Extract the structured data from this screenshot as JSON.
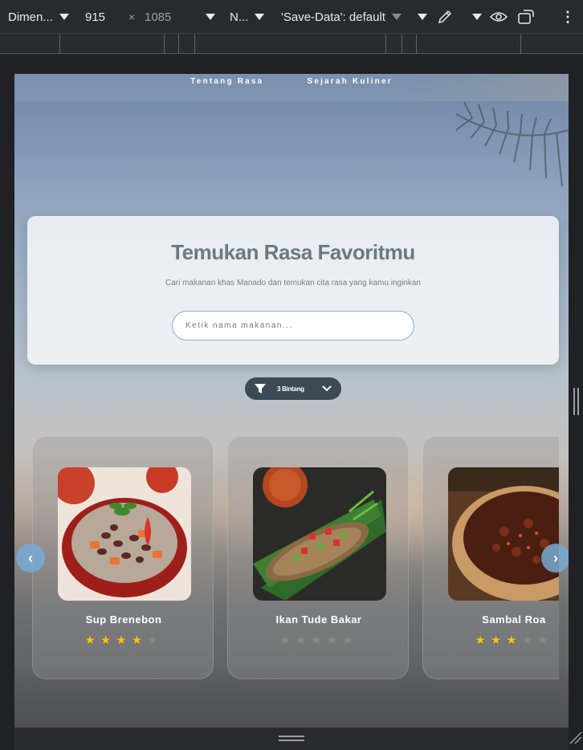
{
  "devtools": {
    "dimensions_label": "Dimen...",
    "width": "915",
    "times": "×",
    "height": "1085",
    "throttle_label": "N...",
    "save_data_label": "'Save-Data': default"
  },
  "nav": {
    "links": [
      "Tentang Rasa",
      "Sejarah Kuliner"
    ]
  },
  "hero": {
    "title": "Temukan Rasa Favoritmu",
    "subtitle": "Cari makanan khas Manado dan temukan cita rasa yang kamu inginkan",
    "search_placeholder": "Ketik nama makanan..."
  },
  "filter": {
    "selected": "3 Bintang"
  },
  "carousel": {
    "prev": "‹",
    "next": "›",
    "items": [
      {
        "name": "Sup Brenebon",
        "rating": 4,
        "max": 5
      },
      {
        "name": "Ikan Tude Bakar",
        "rating": 0,
        "max": 5
      },
      {
        "name": "Sambal Roa",
        "rating": 3,
        "max": 5
      }
    ]
  },
  "colors": {
    "accent": "#7fb0d6",
    "star_on": "#f5c518",
    "star_off": "#8c8a80",
    "filter_bg": "#3c4a56"
  },
  "icons": [
    "chevron-down-icon",
    "close-icon",
    "eyedropper-icon",
    "eye-icon",
    "rotate-icon",
    "more-vertical-icon",
    "filter-icon",
    "chevron-left-icon",
    "chevron-right-icon"
  ]
}
